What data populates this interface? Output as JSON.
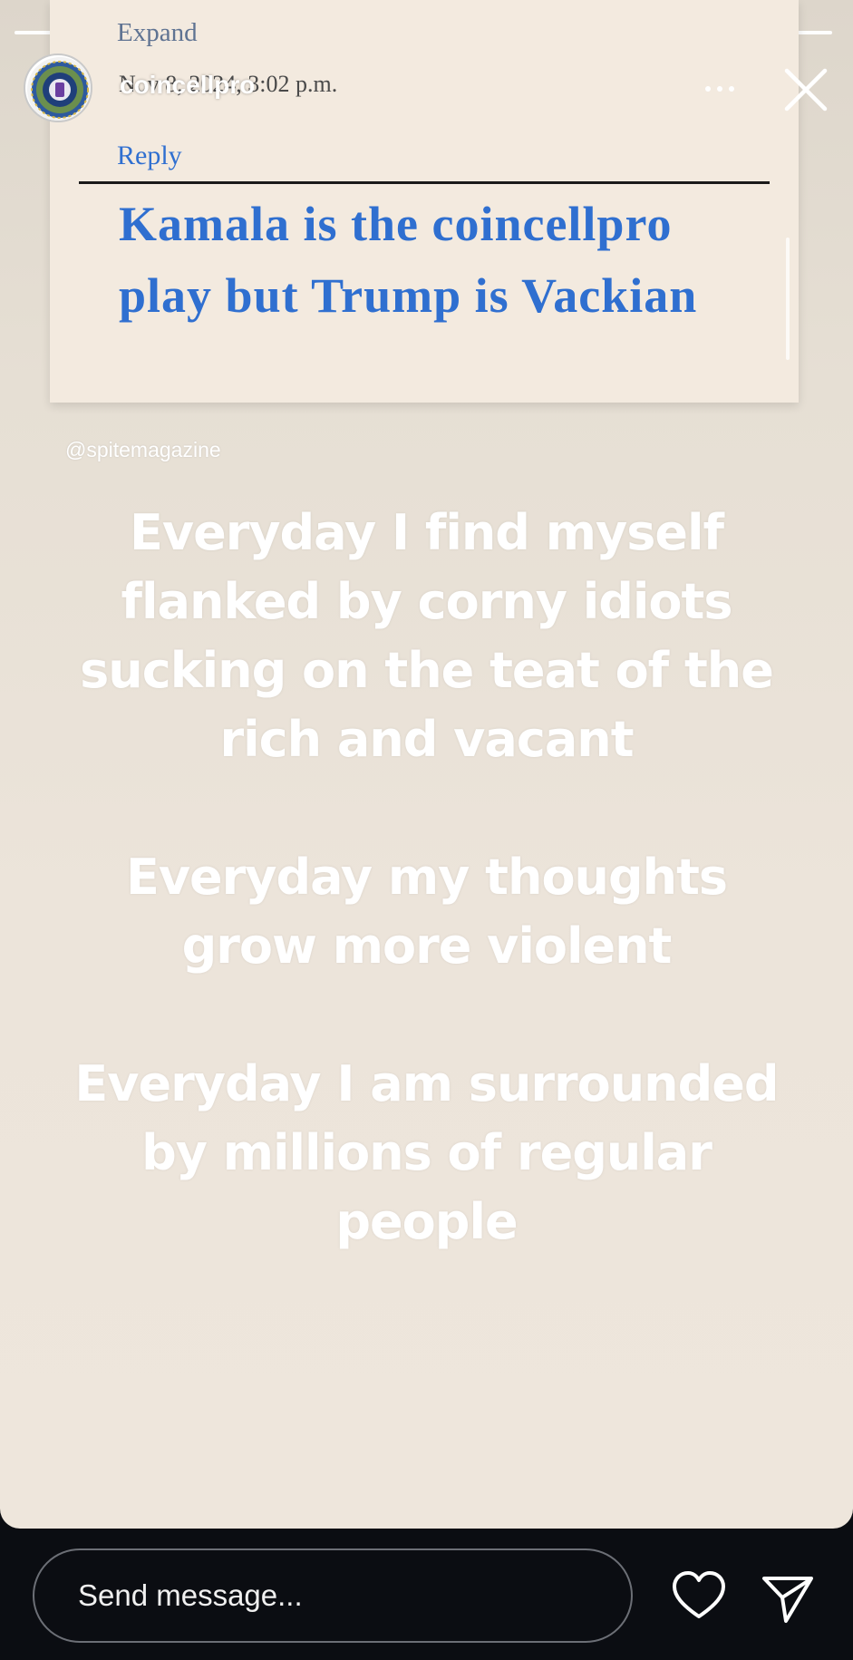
{
  "header": {
    "username": "coincellpro",
    "progress": 1.0
  },
  "embedded_screenshot": {
    "expand_label": "Expand",
    "date": "Nov 8, 2024, 3:02 p.m.",
    "reply_label": "Reply",
    "headline": "Kamala is the coincellpro play but Trump is Vackian"
  },
  "mention": "@spitemagazine",
  "story_text": {
    "paragraph_1": "Everyday I find myself flanked by corny idiots sucking on the teat of the rich and vacant",
    "paragraph_2": "Everyday my thoughts grow more violent",
    "paragraph_3": "Everyday I am surrounded by millions of regular people"
  },
  "footer": {
    "message_placeholder": "Send message..."
  },
  "icons": {
    "more": "more-horizontal-icon",
    "close": "close-icon",
    "like": "heart-icon",
    "send": "send-icon"
  },
  "colors": {
    "link_blue": "#2f6fd0",
    "story_background": "#ece4da",
    "footer_background": "#0b0d12"
  }
}
